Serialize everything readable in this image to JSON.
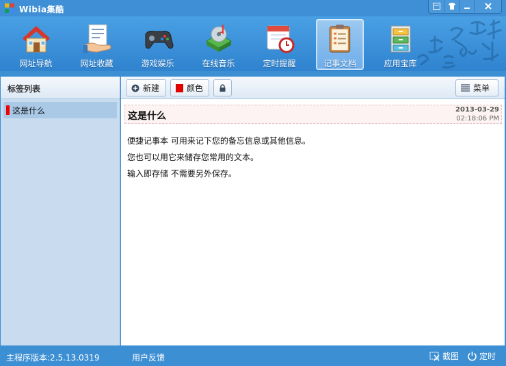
{
  "app": {
    "title": "Wibia集酷"
  },
  "nav": [
    {
      "label": "网址导航",
      "icon": "house-icon"
    },
    {
      "label": "网址收藏",
      "icon": "bookmark-hand-icon"
    },
    {
      "label": "游戏娱乐",
      "icon": "gamepad-icon"
    },
    {
      "label": "在线音乐",
      "icon": "music-disc-icon"
    },
    {
      "label": "定时提醒",
      "icon": "calendar-clock-icon"
    },
    {
      "label": "记事文档",
      "icon": "notepad-icon",
      "active": true
    },
    {
      "label": "应用宝库",
      "icon": "cabinet-icon"
    }
  ],
  "sidebar": {
    "title": "标签列表",
    "items": [
      {
        "label": "这是什么",
        "color": "#e00000"
      }
    ]
  },
  "toolbar": {
    "new_label": "新建",
    "color_label": "颜色",
    "menu_label": "菜单"
  },
  "note": {
    "title": "这是什么",
    "date": "2013-03-29",
    "time": "02:18:06 PM",
    "lines": [
      "便捷记事本 可用来记下您的备忘信息或其他信息。",
      "您也可以用它来储存您常用的文本。",
      "输入即存储 不需要另外保存。"
    ]
  },
  "status": {
    "version": "主程序版本:2.5.13.0319",
    "feedback": "用户反馈",
    "capture": "截图",
    "timer": "定时"
  },
  "colors": {
    "accent": "#3d8fd3",
    "tag_marker": "#e00000"
  }
}
